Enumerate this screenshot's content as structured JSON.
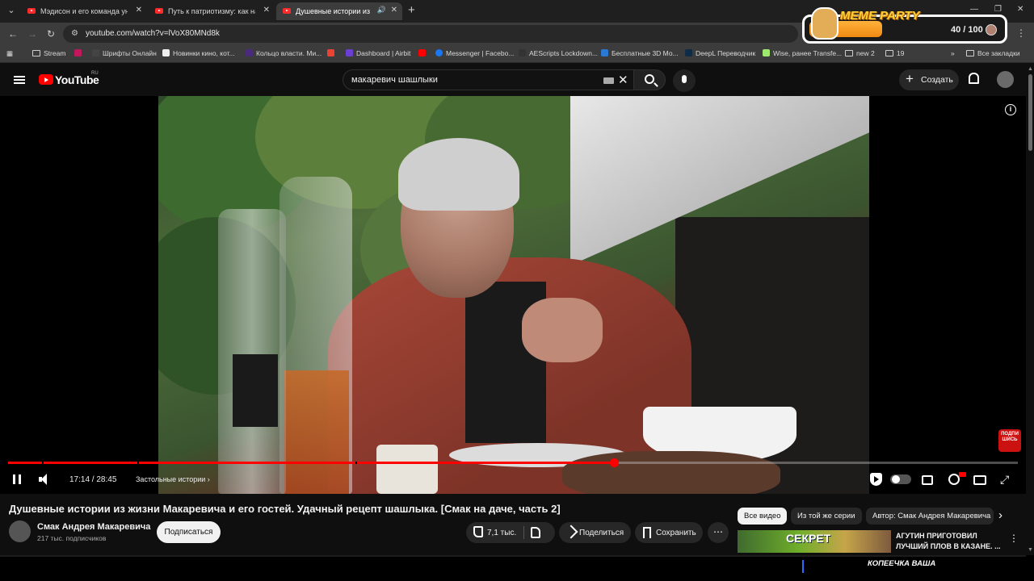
{
  "browser": {
    "tabs": [
      {
        "label": "Мэдисон и его команда унич",
        "active": false
      },
      {
        "label": "Путь к патриотизму: как науч",
        "active": false
      },
      {
        "label": "Душевные истории из жи",
        "active": true
      }
    ],
    "url": "youtube.com/watch?v=lVoX80MNd8k",
    "bookmarks": [
      {
        "label": "Stream",
        "icon": "folder-icon"
      },
      {
        "label": "",
        "icon": "live-icon"
      },
      {
        "label": "Шрифты Онлайн",
        "icon": "font-icon"
      },
      {
        "label": "Новинки кино, кот...",
        "icon": "film-icon"
      },
      {
        "label": "Кольцо власти. Ми...",
        "icon": "ring-icon"
      },
      {
        "label": "",
        "icon": "gmail-icon"
      },
      {
        "label": "Dashboard | Airbit",
        "icon": "airbit-icon"
      },
      {
        "label": "",
        "icon": "youtube-icon"
      },
      {
        "label": "Messenger | Facebo...",
        "icon": "facebook-icon"
      },
      {
        "label": "AEScripts Lockdown...",
        "icon": "aescripts-icon"
      },
      {
        "label": "Бесплатные 3D Мо...",
        "icon": "3d-icon"
      },
      {
        "label": "DeepL Переводчик",
        "icon": "deepl-icon"
      },
      {
        "label": "Wise, ранее Transfe...",
        "icon": "wise-icon"
      },
      {
        "label": "new 2",
        "icon": "folder-icon"
      },
      {
        "label": "19",
        "icon": "folder-icon"
      }
    ],
    "all_bookmarks": "Все закладки"
  },
  "meme_party": {
    "title": "MEME PARTY",
    "count": "40 / 100"
  },
  "youtube": {
    "logo": "YouTube",
    "region": "RU",
    "search_query": "макаревич шашлыки",
    "create_label": "Создать"
  },
  "player": {
    "time": "17:14 / 28:45",
    "chapter": "Застольные истории",
    "progress_fraction": 0.6,
    "watermark": "ПОДПИ ШИСЬ"
  },
  "video": {
    "title": "Душевные истории из жизни Макаревича и его гостей. Удачный рецепт шашлыка. [Смак на даче, часть 2]",
    "channel": "Смак Андрея Макаревича",
    "subscribers": "217 тыс. подписчиков",
    "subscribe_label": "Подписаться",
    "likes": "7,1 тыс.",
    "share_label": "Поделиться",
    "save_label": "Сохранить"
  },
  "chips": [
    "Все видео",
    "Из той же серии",
    "Автор: Смак Андрея Макаревича"
  ],
  "related": {
    "thumb_text": "СЕКРЕТ",
    "title": "АГУТИН ПРИГОТОВИЛ ЛУЧШИЙ ПЛОВ В КАЗАНЕ. ..."
  },
  "bottom_text": "КОПЕЕЧКА ВАША",
  "colors": {
    "accent": "#ff0000",
    "background": "#0f0f0f"
  }
}
